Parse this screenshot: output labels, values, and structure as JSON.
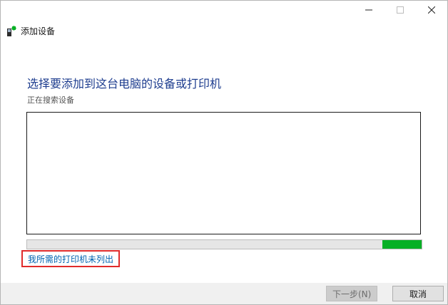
{
  "window": {
    "title": "添加设备",
    "icon": "device-icon"
  },
  "content": {
    "heading": "选择要添加到这台电脑的设备或打印机",
    "status": "正在搜索设备",
    "progress_percent": 10,
    "link_text": "我所需的打印机未列出"
  },
  "footer": {
    "next_label": "下一步(N)",
    "cancel_label": "取消"
  },
  "colors": {
    "heading": "#1e3d8f",
    "link": "#0063b1",
    "progress_fill": "#06b025",
    "highlight_box": "#e02b2b"
  }
}
